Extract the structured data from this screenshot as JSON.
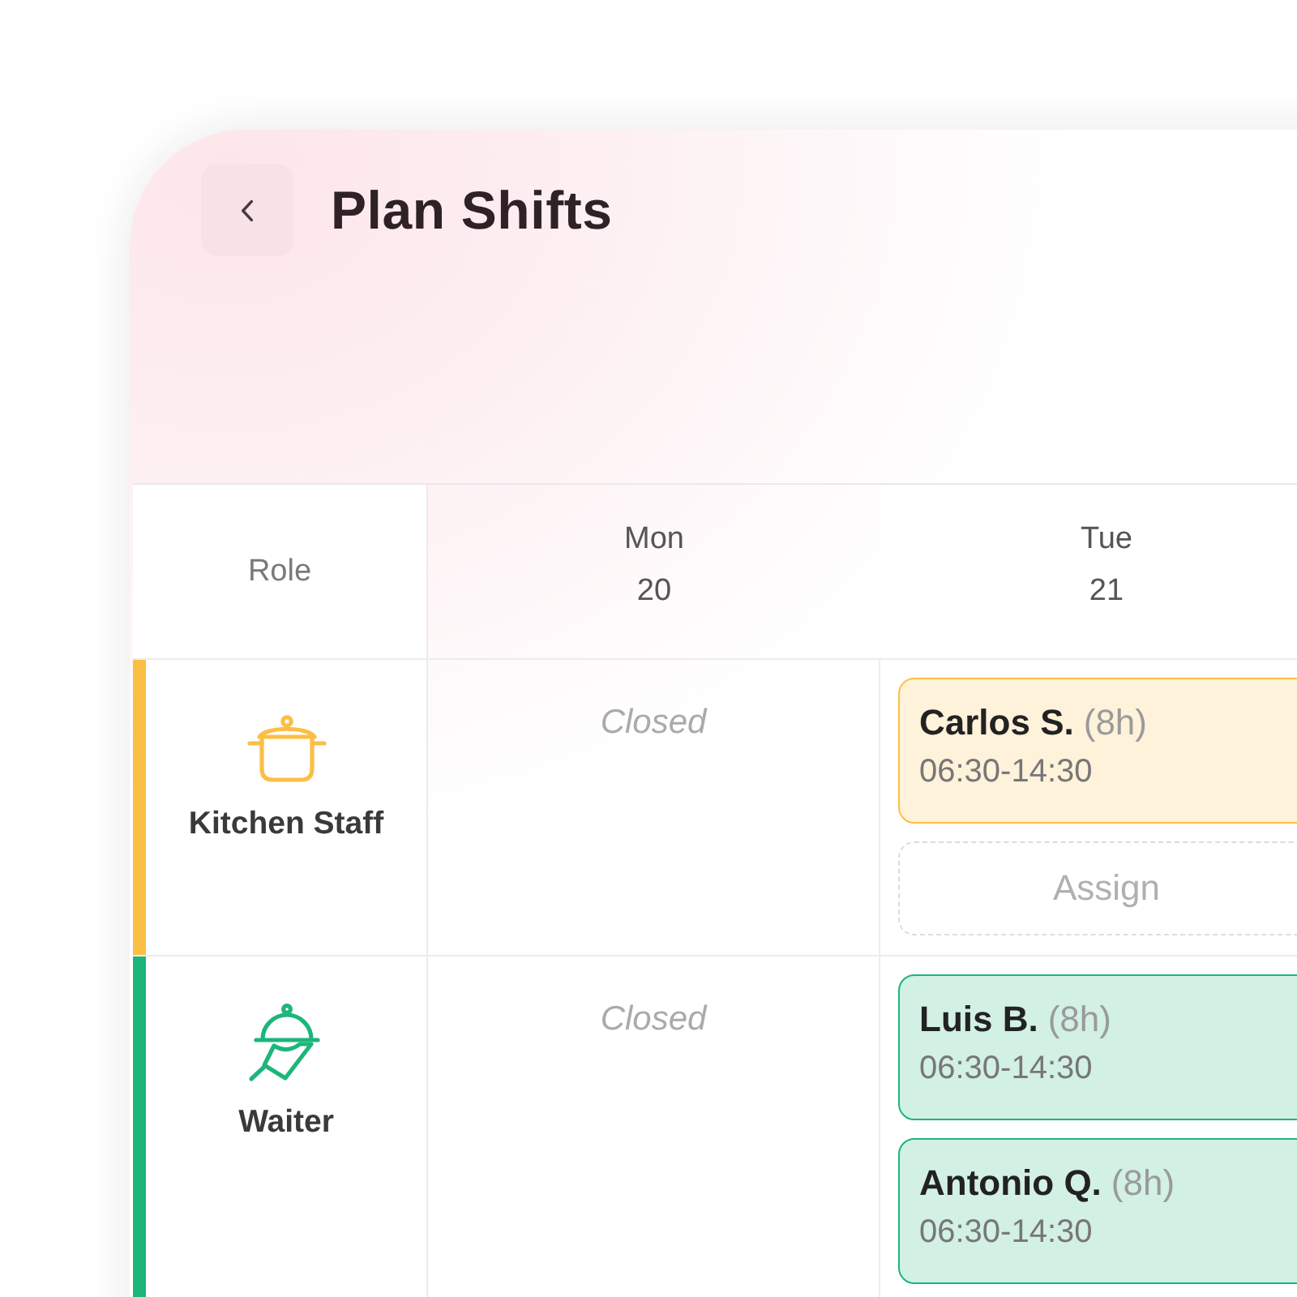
{
  "header": {
    "title": "Plan Shifts"
  },
  "table": {
    "columns": [
      {
        "kind": "role",
        "label": "Role"
      },
      {
        "kind": "day",
        "day": "Mon",
        "date": "20"
      },
      {
        "kind": "day",
        "day": "Tue",
        "date": "21"
      }
    ],
    "rows": [
      {
        "kind": "kitchen",
        "color": "#fbbf45",
        "cells": [
          {
            "kind": "role",
            "text": "Kitchen Staff"
          },
          {
            "kind": "closed",
            "text": "Closed"
          },
          {
            "kind": "shifts",
            "shifts": [
              {
                "name": "Carlos S.",
                "hours": "(8h)",
                "time": "06:30-14:30"
              }
            ],
            "assign": "Assign"
          }
        ]
      },
      {
        "kind": "waiter",
        "color": "#1db67a",
        "cells": [
          {
            "kind": "role",
            "text": "Waiter"
          },
          {
            "kind": "closed",
            "text": "Closed"
          },
          {
            "kind": "shifts",
            "shifts": [
              {
                "name": "Luis B.",
                "hours": "(8h)",
                "time": "06:30-14:30"
              },
              {
                "name": "Antonio Q.",
                "hours": "(8h)",
                "time": "06:30-14:30"
              }
            ]
          }
        ]
      }
    ]
  }
}
